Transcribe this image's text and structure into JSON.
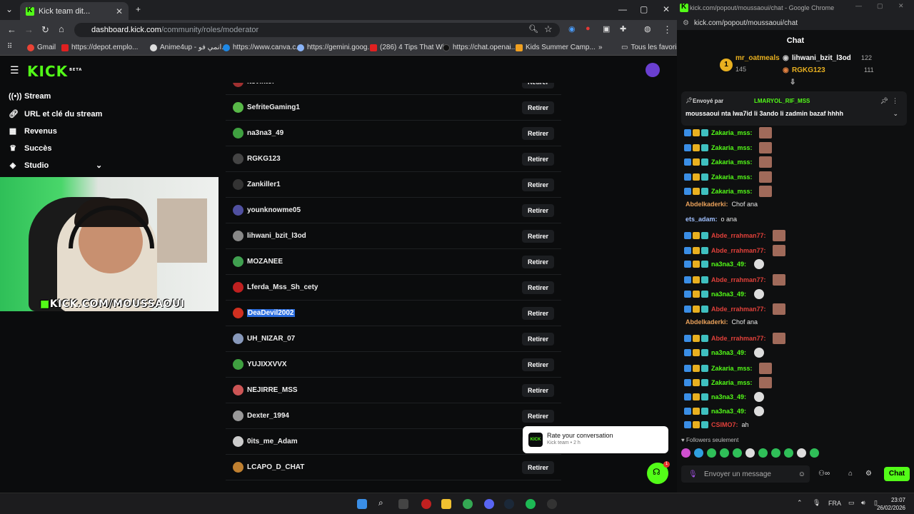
{
  "left_window": {
    "tab_title": "Kick team dit...",
    "url_domain": "dashboard.kick.com",
    "url_path": "/community/roles/moderator",
    "bookmarks": [
      "Gmail",
      "https://depot.emplo...",
      "Anime4up - انمي فو...",
      "https://www.canva.c...",
      "https://gemini.goog...",
      "(286) 4 Tips That Wi...",
      "https://chat.openai....",
      "Kids Summer Camp..."
    ],
    "bookmarks_overflow": "»",
    "all_bookmarks": "Tous les favoris"
  },
  "dashboard": {
    "logo": "KICK",
    "logo_beta": "BETA",
    "sidebar": [
      {
        "label": "Stream",
        "icon": "radio-icon"
      },
      {
        "label": "URL et clé du stream",
        "icon": "link-icon"
      },
      {
        "label": "Revenus",
        "icon": "chart-icon"
      },
      {
        "label": "Succès",
        "icon": "trophy-icon"
      },
      {
        "label": "Studio",
        "icon": "layers-icon"
      }
    ],
    "webcam_banner": "KICK.COM/MOUSSAOUI",
    "remove_label": "Retirer",
    "moderators": [
      {
        "name": "itsviktor",
        "color": "#a03030"
      },
      {
        "name": "SefriteGaming1",
        "color": "#58b848"
      },
      {
        "name": "na3na3_49",
        "color": "#3fa040"
      },
      {
        "name": "RGKG123",
        "color": "#444"
      },
      {
        "name": "Zankiller1",
        "color": "#333"
      },
      {
        "name": "younknowme05",
        "color": "#5050a0"
      },
      {
        "name": "lihwani_bzit_l3od",
        "color": "#888"
      },
      {
        "name": "MOZANEE",
        "color": "#40a050"
      },
      {
        "name": "Lferda_Mss_Sh_cety",
        "color": "#c02020"
      },
      {
        "name": "DeaDevil2002",
        "color": "#d03020"
      },
      {
        "name": "UH_NIZAR_07",
        "color": "#8899bb"
      },
      {
        "name": "YUJIXXVVX",
        "color": "#3fa040"
      },
      {
        "name": "NEJIRRE_MSS",
        "color": "#cc5555"
      },
      {
        "name": "Dexter_1994",
        "color": "#999"
      },
      {
        "name": "0its_me_Adam",
        "color": "#ccc"
      },
      {
        "name": "LCAPO_D_CHAT",
        "color": "#c08030"
      }
    ],
    "toast_title": "Rate your conversation",
    "toast_sub": "Kick team • 2 h",
    "toast_logo": "KICK",
    "fab_badge": "1"
  },
  "right_window": {
    "title": "kick.com/popout/moussaoui/chat - Google Chrome",
    "url": "kick.com/popout/moussaoui/chat",
    "chat_header": "Chat",
    "leaderboard": [
      {
        "rank": "1",
        "name": "mr_oatmeals",
        "count": "145"
      },
      {
        "name": "lihwani_bzit_l3od",
        "count": "122"
      },
      {
        "name": "RGKG123",
        "count": "111"
      }
    ],
    "pinned_by": "Envoyé par",
    "pinned_user": "LMARYOL_RIF_MSS",
    "pinned_text": "moussaoui nta lwa7id li 3ando li zadmin bazaf hhhh",
    "messages": [
      {
        "user": "Zakaria_mss:",
        "color": "#53fc18",
        "text": "",
        "badges": true,
        "emote": true
      },
      {
        "user": "Zakaria_mss:",
        "color": "#53fc18",
        "text": "",
        "badges": true,
        "emote": true
      },
      {
        "user": "Zakaria_mss:",
        "color": "#53fc18",
        "text": "",
        "badges": true,
        "emote": true
      },
      {
        "user": "Zakaria_mss:",
        "color": "#53fc18",
        "text": "",
        "badges": true,
        "emote": true
      },
      {
        "user": "Zakaria_mss:",
        "color": "#53fc18",
        "text": "",
        "badges": true,
        "emote": true
      },
      {
        "user": "Abdelkaderki:",
        "color": "#e8a05a",
        "text": "Chof ana",
        "badges": false,
        "emote": false
      },
      {
        "user": "ets_adam:",
        "color": "#a0c0ff",
        "text": "o ana",
        "badges": false,
        "emote": false
      },
      {
        "user": "Abde_rrahman77:",
        "color": "#e0403a",
        "text": "",
        "badges": true,
        "emote": true
      },
      {
        "user": "Abde_rrahman77:",
        "color": "#e0403a",
        "text": "",
        "badges": true,
        "emote": true
      },
      {
        "user": "na3na3_49:",
        "color": "#53fc18",
        "text": "",
        "badges": true,
        "emote": false
      },
      {
        "user": "Abde_rrahman77:",
        "color": "#e0403a",
        "text": "",
        "badges": true,
        "emote": true
      },
      {
        "user": "na3na3_49:",
        "color": "#53fc18",
        "text": "",
        "badges": true,
        "emote": false
      },
      {
        "user": "Abde_rrahman77:",
        "color": "#e0403a",
        "text": "",
        "badges": true,
        "emote": true
      },
      {
        "user": "Abdelkaderki:",
        "color": "#e8a05a",
        "text": "Chof ana",
        "badges": false,
        "emote": false
      },
      {
        "user": "Abde_rrahman77:",
        "color": "#e0403a",
        "text": "",
        "badges": true,
        "emote": true
      },
      {
        "user": "na3na3_49:",
        "color": "#53fc18",
        "text": "",
        "badges": true,
        "emote": false
      },
      {
        "user": "Zakaria_mss:",
        "color": "#53fc18",
        "text": "",
        "badges": true,
        "emote": true
      },
      {
        "user": "Zakaria_mss:",
        "color": "#53fc18",
        "text": "",
        "badges": true,
        "emote": true
      },
      {
        "user": "na3na3_49:",
        "color": "#53fc18",
        "text": "",
        "badges": true,
        "emote": false
      },
      {
        "user": "na3na3_49:",
        "color": "#53fc18",
        "text": "",
        "badges": true,
        "emote": false
      },
      {
        "user": "CSIMO7:",
        "color": "#e0403a",
        "text": "ah",
        "badges": true,
        "emote": false
      }
    ],
    "followers_only": "Followers seulement",
    "input_placeholder": "Envoyer un message",
    "chat_button": "Chat"
  },
  "taskbar": {
    "lang": "FRA",
    "time": "23:07",
    "date": "26/02/2026"
  },
  "colors": {
    "brand": "#53fc18",
    "bg": "#0b0c0d"
  }
}
